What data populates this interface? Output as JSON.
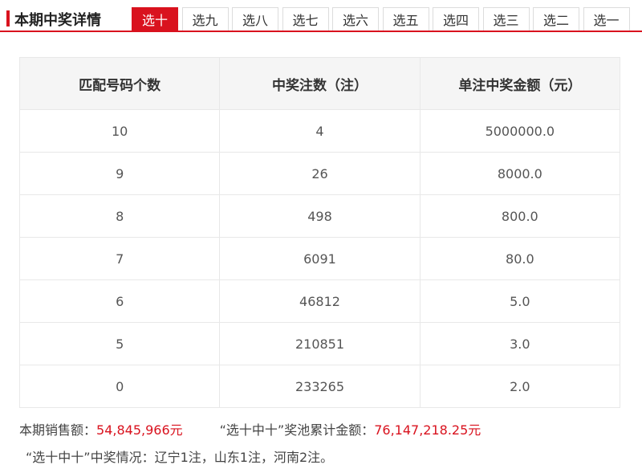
{
  "header": {
    "title": "本期中奖详情",
    "tabs": [
      "选十",
      "选九",
      "选八",
      "选七",
      "选六",
      "选五",
      "选四",
      "选三",
      "选二",
      "选一"
    ],
    "active_tab": "选十"
  },
  "table": {
    "columns": [
      "匹配号码个数",
      "中奖注数（注）",
      "单注中奖金额（元）"
    ],
    "rows": [
      [
        "10",
        "4",
        "5000000.0"
      ],
      [
        "9",
        "26",
        "8000.0"
      ],
      [
        "8",
        "498",
        "800.0"
      ],
      [
        "7",
        "6091",
        "80.0"
      ],
      [
        "6",
        "46812",
        "5.0"
      ],
      [
        "5",
        "210851",
        "3.0"
      ],
      [
        "0",
        "233265",
        "2.0"
      ]
    ]
  },
  "summary": {
    "sales_label": "本期销售额：",
    "sales_value": "54,845,966元",
    "pool_label": "“选十中十”奖池累计金额：",
    "pool_value": "76,147,218.25元",
    "winners_text": "“选十中十”中奖情况：辽宁1注，山东1注，河南2注。"
  },
  "colors": {
    "accent": "#d9121e"
  }
}
